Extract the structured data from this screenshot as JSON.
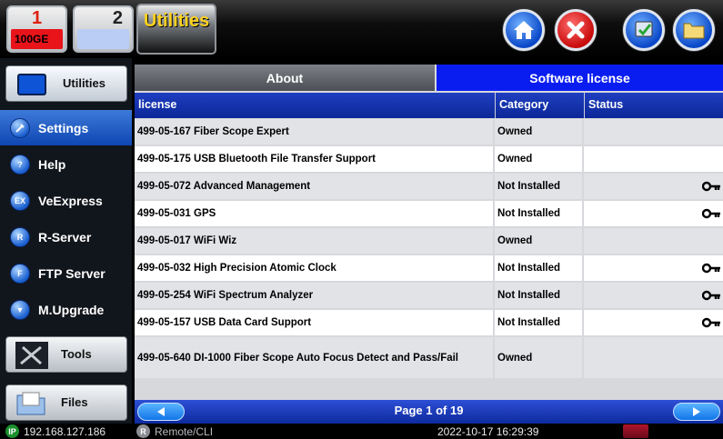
{
  "topbar": {
    "port1": {
      "number": "1",
      "label": "100GE"
    },
    "port2": {
      "number": "2",
      "label": ""
    },
    "app_title": "Utilities",
    "icons": [
      "home-icon",
      "close-icon",
      "settings-tool-icon",
      "folder-icon"
    ]
  },
  "sidebar": {
    "utilities_label": "Utilities",
    "items": [
      {
        "label": "Settings",
        "icon": "settings-icon",
        "badge": "",
        "active": true
      },
      {
        "label": "Help",
        "icon": "help-icon",
        "badge": "?",
        "active": false
      },
      {
        "label": "VeExpress",
        "icon": "veexpress-icon",
        "badge": "EX",
        "active": false
      },
      {
        "label": "R-Server",
        "icon": "r-server-icon",
        "badge": "R",
        "active": false
      },
      {
        "label": "FTP Server",
        "icon": "ftp-server-icon",
        "badge": "F",
        "active": false
      },
      {
        "label": "M.Upgrade",
        "icon": "upgrade-icon",
        "badge": "▼",
        "active": false
      }
    ],
    "tools_label": "Tools",
    "files_label": "Files"
  },
  "tabs": {
    "about": "About",
    "software_license": "Software license",
    "active": "software_license"
  },
  "table": {
    "headers": {
      "license": "license",
      "category": "Category",
      "status": "Status"
    },
    "rows": [
      {
        "license": "499-05-167 Fiber Scope Expert",
        "category": "Owned",
        "status": "",
        "key": false
      },
      {
        "license": "499-05-175 USB Bluetooth File Transfer Support",
        "category": "Owned",
        "status": "",
        "key": false
      },
      {
        "license": "499-05-072 Advanced Management",
        "category": "Not Installed",
        "status": "",
        "key": true
      },
      {
        "license": "499-05-031 GPS",
        "category": "Not Installed",
        "status": "",
        "key": true
      },
      {
        "license": "499-05-017 WiFi Wiz",
        "category": "Owned",
        "status": "",
        "key": false
      },
      {
        "license": "499-05-032 High Precision Atomic Clock",
        "category": "Not Installed",
        "status": "",
        "key": true
      },
      {
        "license": "499-05-254 WiFi Spectrum Analyzer",
        "category": "Not Installed",
        "status": "",
        "key": true
      },
      {
        "license": "499-05-157 USB Data Card Support",
        "category": "Not Installed",
        "status": "",
        "key": true
      },
      {
        "license": "499-05-640 DI-1000 Fiber Scope Auto Focus Detect and Pass/Fail",
        "category": "Owned",
        "status": "",
        "key": false
      }
    ]
  },
  "pager": {
    "label": "Page 1 of 19"
  },
  "statusbar": {
    "ip_badge": "IP",
    "ip": "192.168.127.186",
    "remote_badge": "R",
    "remote": "Remote/CLI",
    "datetime": "2022-10-17  16:29:39"
  }
}
